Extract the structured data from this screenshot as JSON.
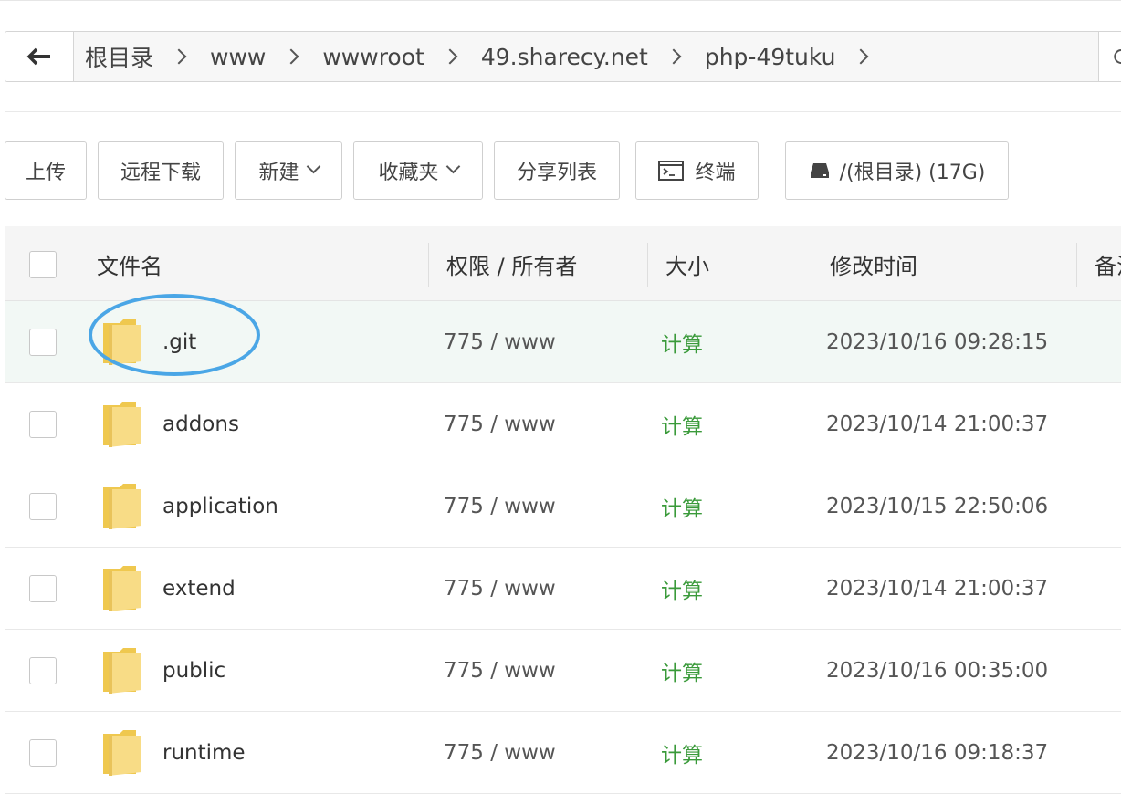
{
  "breadcrumb": {
    "items": [
      "根目录",
      "www",
      "wwwroot",
      "49.sharecy.net",
      "php-49tuku"
    ]
  },
  "toolbar": {
    "upload": "上传",
    "remote_download": "远程下载",
    "new": "新建",
    "favorites": "收藏夹",
    "share_list": "分享列表",
    "terminal": "终端",
    "disk": "/(根目录) (17G)"
  },
  "table": {
    "headers": {
      "name": "文件名",
      "permission": "权限 / 所有者",
      "size": "大小",
      "mtime": "修改时间",
      "remark": "备注"
    },
    "rows": [
      {
        "name": ".git",
        "permission": "775 / www",
        "size": "计算",
        "mtime": "2023/10/16 09:28:15"
      },
      {
        "name": "addons",
        "permission": "775 / www",
        "size": "计算",
        "mtime": "2023/10/14 21:00:37"
      },
      {
        "name": "application",
        "permission": "775 / www",
        "size": "计算",
        "mtime": "2023/10/15 22:50:06"
      },
      {
        "name": "extend",
        "permission": "775 / www",
        "size": "计算",
        "mtime": "2023/10/14 21:00:37"
      },
      {
        "name": "public",
        "permission": "775 / www",
        "size": "计算",
        "mtime": "2023/10/16 00:35:00"
      },
      {
        "name": "runtime",
        "permission": "775 / www",
        "size": "计算",
        "mtime": "2023/10/16 09:18:37"
      }
    ]
  },
  "colors": {
    "calc_green": "#3a9a3a",
    "highlight_circle": "#4aa6e6",
    "folder_yellow": "#f6d77a",
    "selected_row": "#f2f8f5"
  }
}
